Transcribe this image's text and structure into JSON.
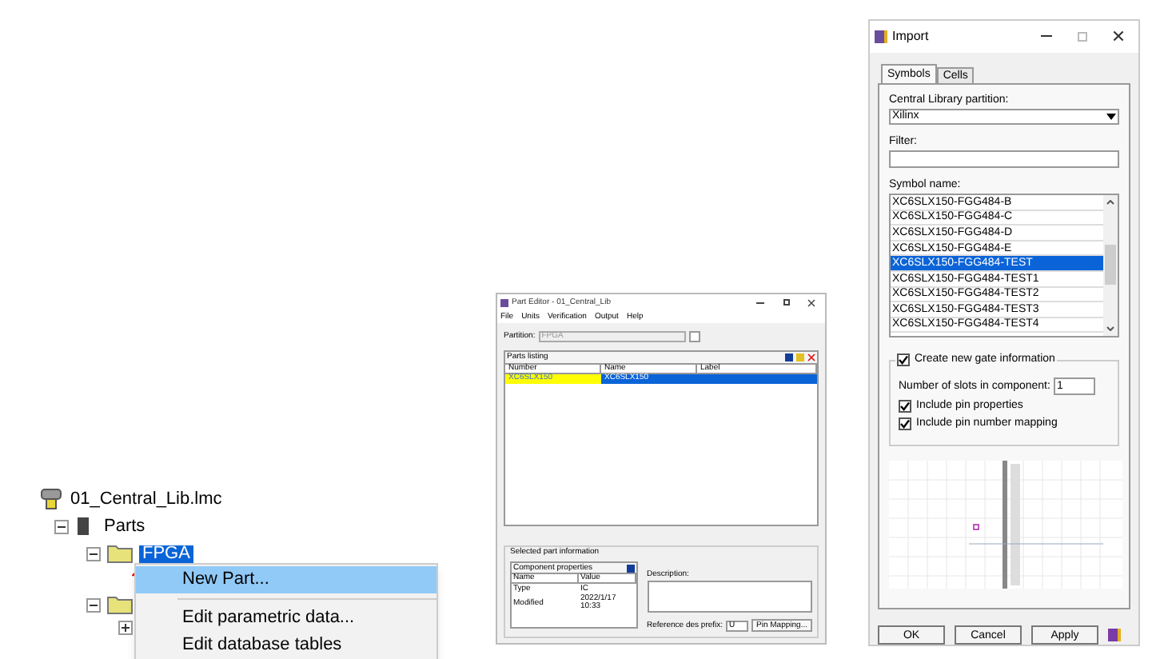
{
  "tree": {
    "label": "01_Central_Lib.lmc",
    "children": [
      {
        "label": "Parts",
        "children": [
          {
            "label": "FPGA",
            "selected": true
          }
        ]
      }
    ]
  },
  "context_menu": [
    {
      "label": "New Part...",
      "selected": true
    },
    {
      "label": "Edit parametric data...",
      "selected": false
    },
    {
      "label": "Edit database tables",
      "selected": false
    }
  ],
  "part_editor": {
    "title": "Part Editor - 01_Central_Lib",
    "menu": [
      "File",
      "Units",
      "Verification",
      "Output",
      "Help"
    ],
    "partition_label": "Partition:",
    "partition_value": "FPGA",
    "listing_title": "Parts listing",
    "columns": [
      "Number",
      "Name",
      "Label"
    ],
    "rows": [
      {
        "number": "XC6SLX150",
        "name": "XC6SLX150",
        "selected": true
      }
    ],
    "info_title": "Selected part information",
    "props_title": "Component properties",
    "props_columns": [
      "Name",
      "Value"
    ],
    "props_rows": [
      {
        "name": "Type",
        "value": "IC"
      },
      {
        "name": "Modified",
        "value": "2022/1/17 10:33"
      }
    ],
    "description_label": "Description:",
    "prefix_label": "Reference des prefix:",
    "prefix_value": "U",
    "pin_mapping_button": "Pin Mapping..."
  },
  "import_dialog": {
    "title": "Import",
    "tabs": [
      {
        "label": "Symbols",
        "selected": true
      },
      {
        "label": "Cells",
        "selected": false
      }
    ],
    "partition_label": "Central Library partition:",
    "partition_value": "Xilinx",
    "filter_label": "Filter:",
    "symbol_label": "Symbol name:",
    "symbols": [
      {
        "label": "XC6SLX150-FGG484-B",
        "selected": false
      },
      {
        "label": "XC6SLX150-FGG484-C",
        "selected": false
      },
      {
        "label": "XC6SLX150-FGG484-D",
        "selected": false
      },
      {
        "label": "XC6SLX150-FGG484-E",
        "selected": false
      },
      {
        "label": "XC6SLX150-FGG484-TEST",
        "selected": true
      },
      {
        "label": "XC6SLX150-FGG484-TEST1",
        "selected": false
      },
      {
        "label": "XC6SLX150-FGG484-TEST2",
        "selected": false
      },
      {
        "label": "XC6SLX150-FGG484-TEST3",
        "selected": false
      },
      {
        "label": "XC6SLX150-FGG484-TEST4",
        "selected": false
      }
    ],
    "create_gate": {
      "label": "Create new gate information",
      "checked": true
    },
    "slots_label": "Number of slots in component:",
    "slots_value": "1",
    "options": [
      {
        "label": "Include pin properties",
        "checked": true
      },
      {
        "label": "Include pin number mapping",
        "checked": true
      }
    ],
    "buttons": [
      "OK",
      "Cancel",
      "Apply"
    ]
  }
}
